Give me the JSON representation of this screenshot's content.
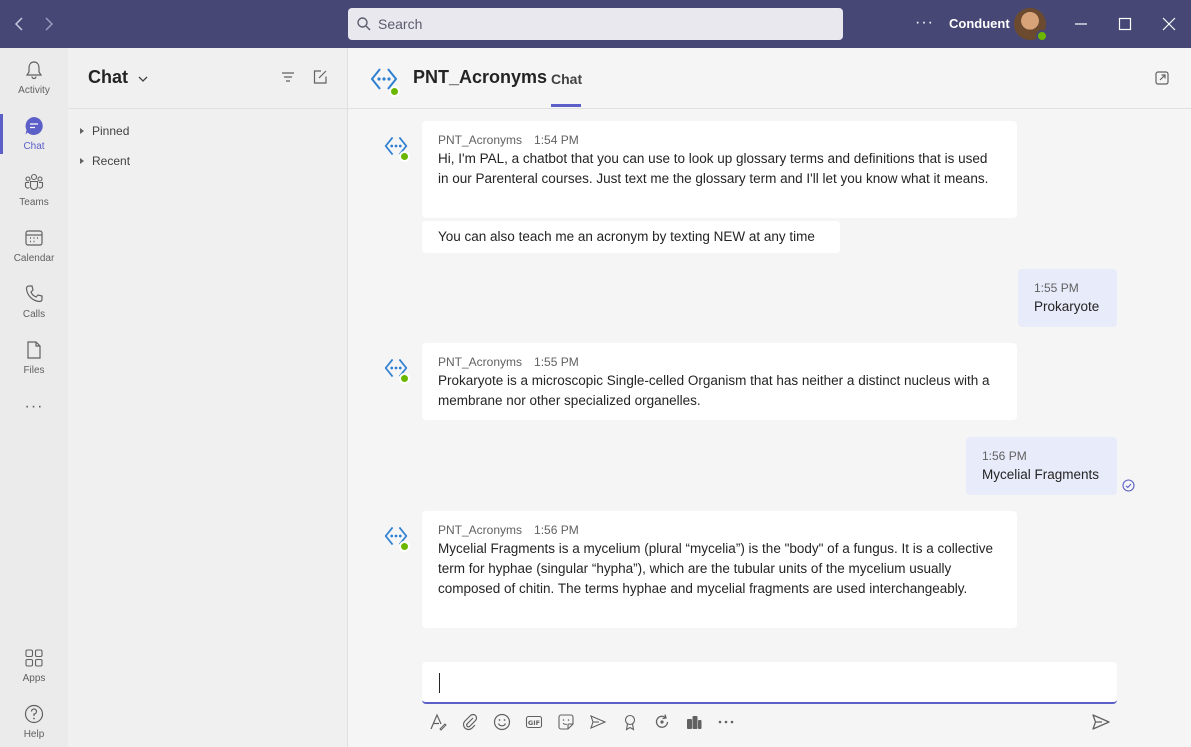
{
  "titlebar": {
    "search_placeholder": "Search",
    "more_label": "···",
    "org_name": "Conduent"
  },
  "rail": {
    "items": [
      {
        "label": "Activity"
      },
      {
        "label": "Chat"
      },
      {
        "label": "Teams"
      },
      {
        "label": "Calendar"
      },
      {
        "label": "Calls"
      },
      {
        "label": "Files"
      },
      {
        "label": "···"
      },
      {
        "label": "Apps"
      },
      {
        "label": "Help"
      }
    ]
  },
  "chatlist": {
    "title": "Chat",
    "sections": [
      {
        "label": "Pinned"
      },
      {
        "label": "Recent"
      }
    ]
  },
  "main": {
    "title": "PNT_Acronyms",
    "tab": "Chat"
  },
  "messages": [
    {
      "sender": "PNT_Acronyms",
      "time": "1:54 PM",
      "text": "Hi, I'm PAL, a chatbot that you can use to look up glossary terms and definitions that is used in our Parenteral courses. Just text me the glossary term and I'll let you know what it means."
    },
    {
      "text": "You can also teach me an acronym by texting NEW at any time"
    },
    {
      "time": "1:55 PM",
      "text": "Prokaryote"
    },
    {
      "sender": "PNT_Acronyms",
      "time": "1:55 PM",
      "text": "Prokaryote is a microscopic Single-celled Organism that has neither a distinct nucleus with a membrane nor other specialized organelles."
    },
    {
      "time": "1:56 PM",
      "text": "Mycelial Fragments"
    },
    {
      "sender": "PNT_Acronyms",
      "time": "1:56 PM",
      "text": "Mycelial Fragments is a mycelium (plural “mycelia”) is the \"body\" of a fungus. It is a collective term for hyphae (singular “hypha”), which are the tubular units of the mycelium usually composed of chitin. The terms hyphae and mycelial fragments are used interchangeably."
    }
  ],
  "colors": {
    "titlebar": "#464775",
    "accent": "#5b5fc7",
    "presence": "#6bb700",
    "bot_logo": "#2f7fd1"
  }
}
